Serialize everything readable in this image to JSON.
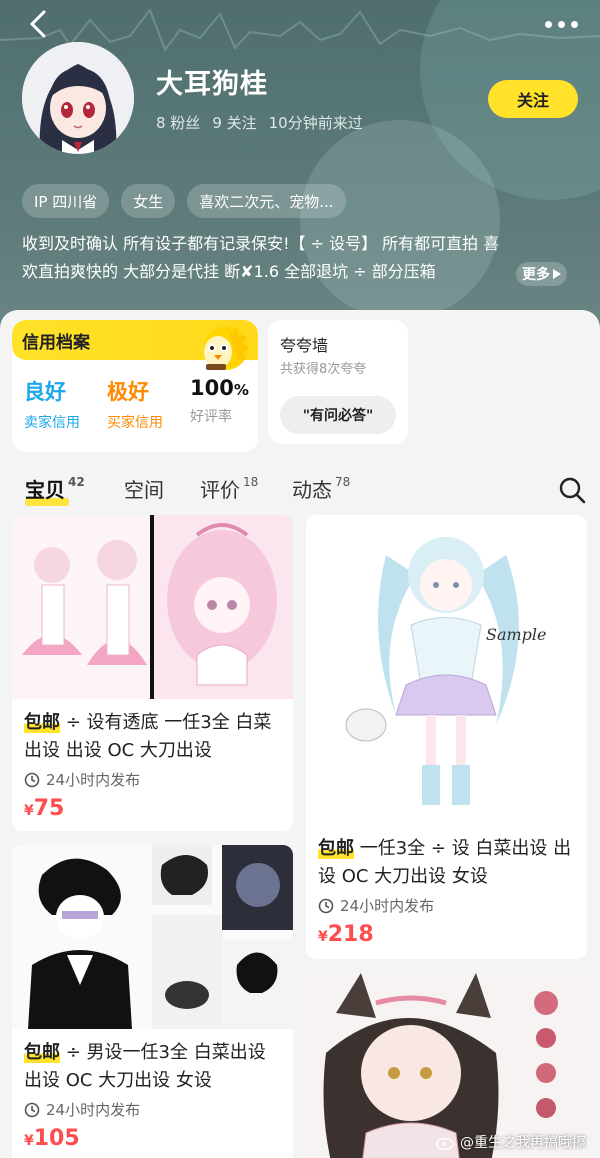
{
  "profile": {
    "name": "大耳狗桂",
    "fans": "8 粉丝",
    "following": "9 关注",
    "last_seen": "10分钟前来过",
    "follow_label": "关注"
  },
  "tags": [
    "IP 四川省",
    "女生",
    "喜欢二次元、宠物..."
  ],
  "bio": {
    "line1": "收到及时确认 所有设子都有记录保安!【 ÷ 设号】 所有都可直拍 喜",
    "line2": "欢直拍爽快的 大部分是代挂 断✘1.6 全部退坑 ÷  部分压箱",
    "more_label": "更多"
  },
  "credit": {
    "title": "信用档案",
    "seller_value": "良好",
    "seller_label": "卖家信用",
    "buyer_value": "极好",
    "buyer_label": "买家信用",
    "rate_value": "100",
    "rate_unit": "%",
    "rate_label": "好评率"
  },
  "praise": {
    "title": "夸夸墙",
    "subtitle": "共获得8次夸夸",
    "pill": "\"有问必答\""
  },
  "tabs": [
    {
      "label": "宝贝",
      "count": "42"
    },
    {
      "label": "空间",
      "count": ""
    },
    {
      "label": "评价",
      "count": "18"
    },
    {
      "label": "动态",
      "count": "78"
    }
  ],
  "products": [
    {
      "badge": "包邮",
      "title": " ÷ 设有透底 一任3全 白菜出设  出设  OC  大刀出设",
      "time": "24小时内发布",
      "currency": "¥",
      "price": "75"
    },
    {
      "badge": "包邮",
      "title": " 一任3全 ÷ 设 白菜出设 出设  OC  大刀出设  女设",
      "time": "24小时内发布",
      "currency": "¥",
      "price": "218"
    },
    {
      "badge": "包邮",
      "title": " ÷ 男设一任3全 白菜出设  出设  OC  大刀出设  女设",
      "time": "24小时内发布",
      "currency": "¥",
      "price": "105"
    }
  ],
  "watermark": "@重生之我再搞哦擦",
  "colors": {
    "accent": "#ffe229",
    "price": "#ff4d4f",
    "seller": "#1aa7ec",
    "buyer": "#ff8a00"
  }
}
